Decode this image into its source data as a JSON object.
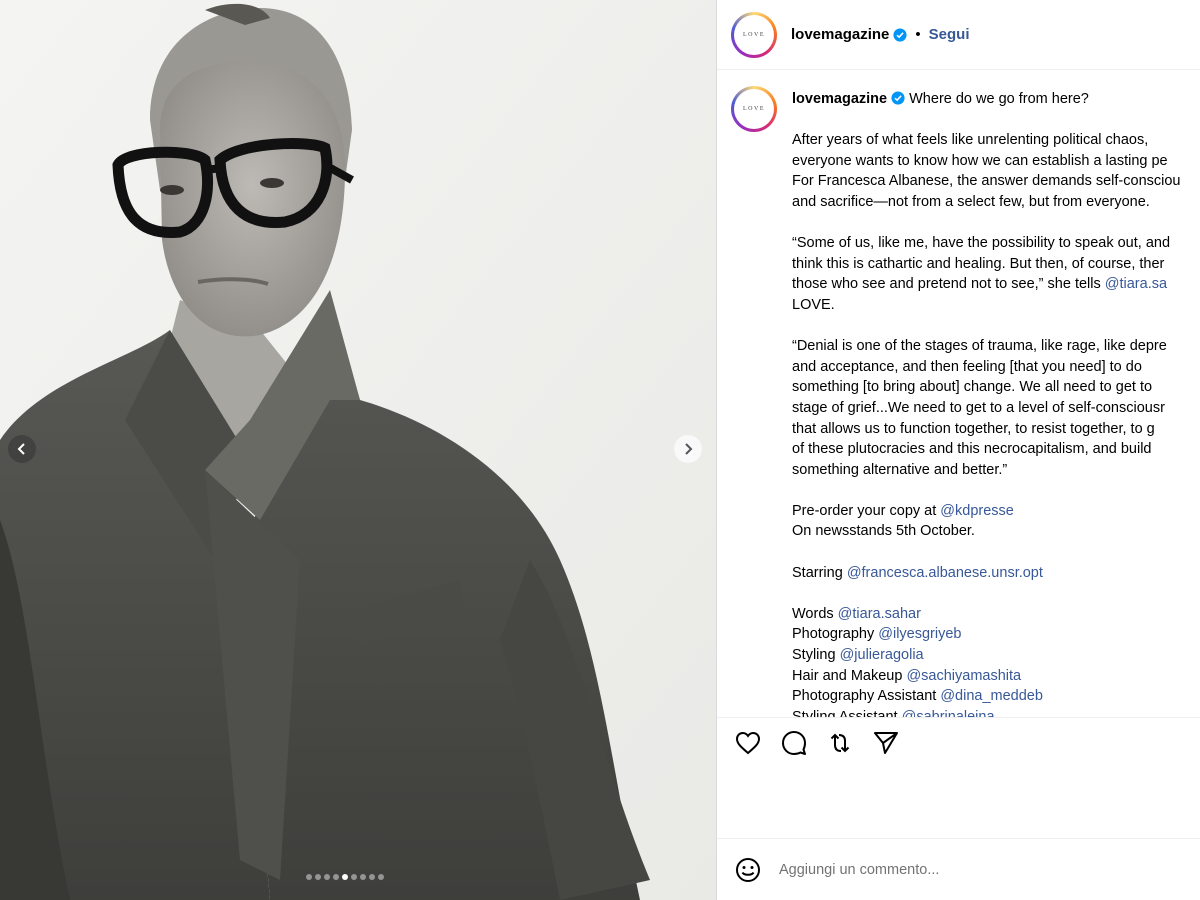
{
  "post": {
    "username": "lovemagazine",
    "follow_label": "Segui",
    "bullet": "•",
    "avatar_text": "LOVE",
    "carousel": {
      "total_slides": 9,
      "active_index": 4
    }
  },
  "caption": {
    "username": "lovemagazine",
    "lines": [
      {
        "parts": [
          {
            "t": "Where do we go from here?"
          }
        ]
      },
      {
        "gap": true
      },
      {
        "parts": [
          {
            "t": "After years of what feels like unrelenting political chaos,"
          }
        ]
      },
      {
        "parts": [
          {
            "t": "everyone wants to know how we can establish a lasting pe"
          }
        ]
      },
      {
        "parts": [
          {
            "t": "For Francesca Albanese, the answer demands self-consciou"
          }
        ]
      },
      {
        "parts": [
          {
            "t": "and sacrifice—not from a select few, but from everyone."
          }
        ]
      },
      {
        "gap": true
      },
      {
        "parts": [
          {
            "t": "“Some of us, like me, have the possibility to speak out, and"
          }
        ]
      },
      {
        "parts": [
          {
            "t": "think this is cathartic and healing. But then, of course, ther"
          }
        ]
      },
      {
        "parts": [
          {
            "t": "those who see and pretend not to see,” she tells "
          },
          {
            "t": "@tiara.sa",
            "m": true
          }
        ]
      },
      {
        "parts": [
          {
            "t": "LOVE."
          }
        ]
      },
      {
        "gap": true
      },
      {
        "parts": [
          {
            "t": "“Denial is one of the stages of trauma, like rage, like depre"
          }
        ]
      },
      {
        "parts": [
          {
            "t": "and acceptance, and then feeling [that you need] to do"
          }
        ]
      },
      {
        "parts": [
          {
            "t": "something [to bring about] change. We all need to get to"
          }
        ]
      },
      {
        "parts": [
          {
            "t": "stage of grief...We need to get to a level of self-consciousr"
          }
        ]
      },
      {
        "parts": [
          {
            "t": "that allows us to function together, to resist together, to g"
          }
        ]
      },
      {
        "parts": [
          {
            "t": "of these plutocracies and this necrocapitalism, and build"
          }
        ]
      },
      {
        "parts": [
          {
            "t": "something alternative and better.”"
          }
        ]
      },
      {
        "gap": true
      },
      {
        "parts": [
          {
            "t": "Pre-order your copy at "
          },
          {
            "t": "@kdpresse",
            "m": true
          }
        ]
      },
      {
        "parts": [
          {
            "t": "On newsstands 5th October."
          }
        ]
      },
      {
        "gap": true
      },
      {
        "parts": [
          {
            "t": "Starring "
          },
          {
            "t": "@francesca.albanese.unsr.opt",
            "m": true
          }
        ]
      },
      {
        "gap": true
      },
      {
        "parts": [
          {
            "t": "Words "
          },
          {
            "t": "@tiara.sahar",
            "m": true
          }
        ]
      },
      {
        "parts": [
          {
            "t": "Photography "
          },
          {
            "t": "@ilyesgriyeb",
            "m": true
          }
        ]
      },
      {
        "parts": [
          {
            "t": "Styling "
          },
          {
            "t": "@julieragolia",
            "m": true
          }
        ]
      },
      {
        "parts": [
          {
            "t": "Hair and Makeup "
          },
          {
            "t": "@sachiyamashita",
            "m": true
          }
        ]
      },
      {
        "parts": [
          {
            "t": "Photography Assistant "
          },
          {
            "t": "@dina_meddeb",
            "m": true
          }
        ]
      },
      {
        "parts": [
          {
            "t": "Styling Assistant "
          },
          {
            "t": "@sabrinaleina",
            "m": true
          }
        ]
      }
    ]
  },
  "actions": {
    "like_icon": "heart-icon",
    "comment_icon": "comment-icon",
    "repost_icon": "repost-icon",
    "share_icon": "send-icon"
  },
  "comment": {
    "placeholder": "Aggiungi un commento..."
  },
  "colors": {
    "link": "#385898",
    "verified": "#0095f6",
    "border": "#dbdbdb"
  }
}
